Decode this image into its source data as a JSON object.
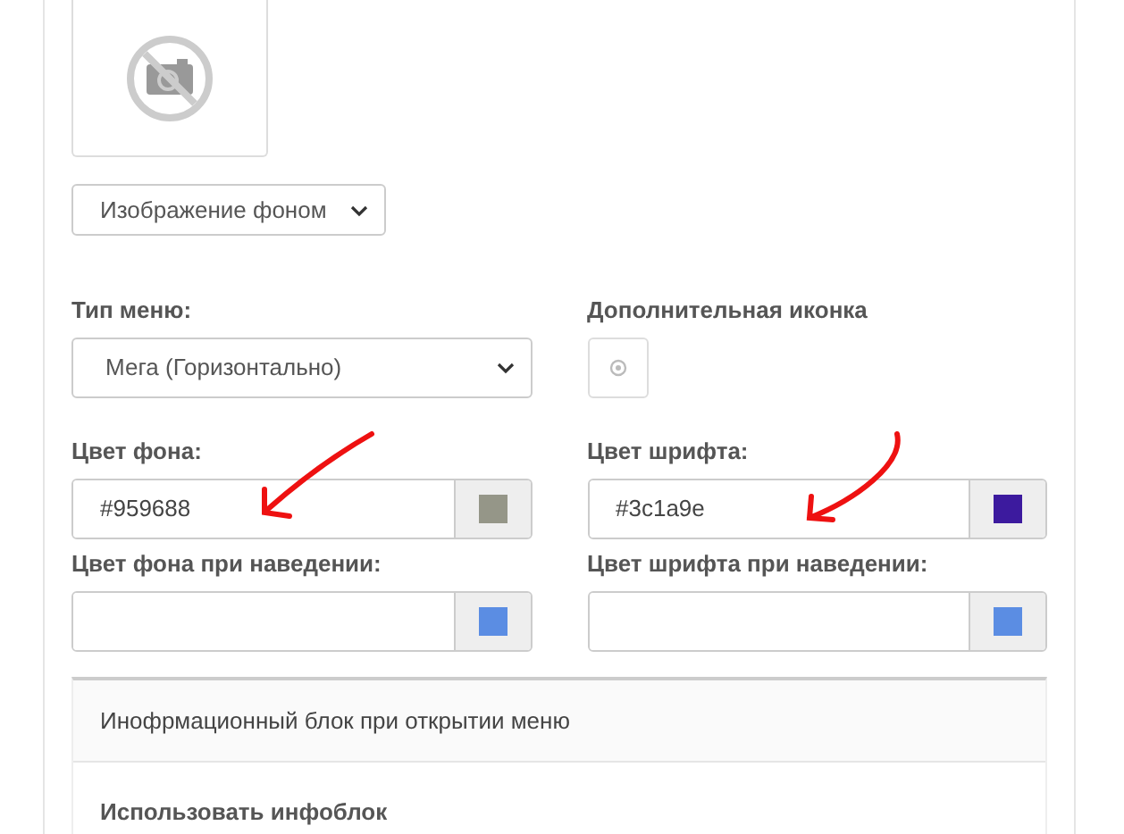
{
  "background_select": {
    "value": "Изображение фоном"
  },
  "menu_type": {
    "label": "Тип меню:",
    "value": "Мега (Горизонтально)"
  },
  "extra_icon": {
    "label": "Дополнительная иконка"
  },
  "color_fields": [
    {
      "label": "Цвет фона:",
      "value": "#959688",
      "color": "#959688"
    },
    {
      "label": "Цвет шрифта:",
      "value": "#3c1a9e",
      "color": "#3c1a9e"
    },
    {
      "label": "Цвет фона при наведении:",
      "color": "#5b8de3"
    },
    {
      "label": "Цвет шрифта при наведении:",
      "color": "#5b8de3"
    }
  ],
  "info_panel": {
    "title": "Инофрмационный блок при открытии меню",
    "field_label": "Использовать инфоблок"
  }
}
